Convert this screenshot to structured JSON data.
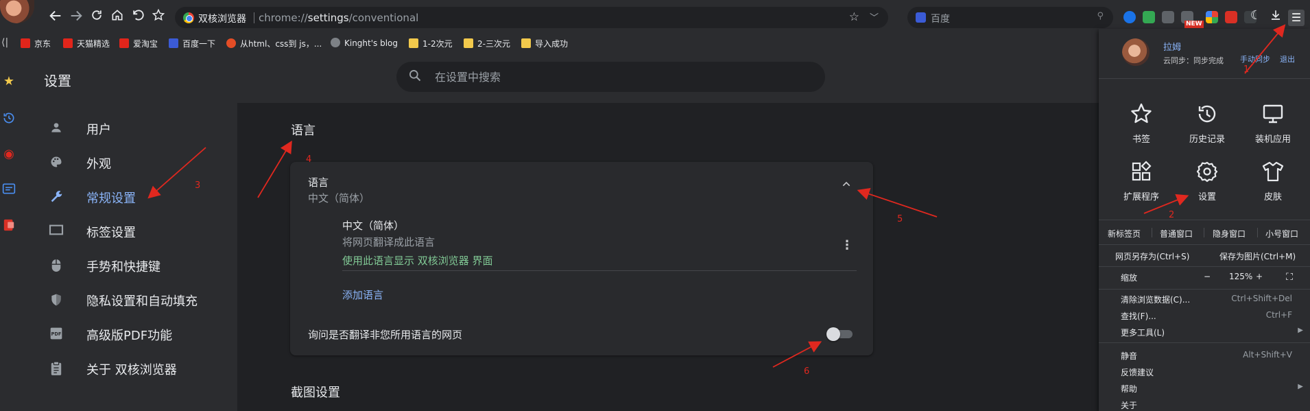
{
  "browser": {
    "omnibox": {
      "name": "双核浏览器",
      "url_prefix": "chrome://",
      "url_path": "settings",
      "url_rest": "/conventional"
    },
    "search_engine": {
      "placeholder": "百度"
    },
    "ext_badge": "NEW",
    "bookmarks": [
      {
        "label": "京东",
        "icon": "jd-icon",
        "color": "#e1251b"
      },
      {
        "label": "天猫精选",
        "icon": "tmall-icon",
        "color": "#e1251b"
      },
      {
        "label": "爱淘宝",
        "icon": "taobao-icon",
        "color": "#e1251b"
      },
      {
        "label": "百度一下",
        "icon": "baidu-icon",
        "color": "#3b5bd6"
      },
      {
        "label": "从html、css到 js，...",
        "icon": "html-icon",
        "color": "#e44d26"
      },
      {
        "label": "Kinght's blog",
        "icon": "globe-icon",
        "color": "#7d8186"
      },
      {
        "label": "1-2次元",
        "icon": "folder-icon",
        "color": "#f2c94c"
      },
      {
        "label": "2-三次元",
        "icon": "folder-icon",
        "color": "#f2c94c"
      },
      {
        "label": "导入成功",
        "icon": "folder-icon",
        "color": "#f2c94c"
      }
    ]
  },
  "settings": {
    "title": "设置",
    "search_placeholder": "在设置中搜索",
    "nav": [
      {
        "label": "用户",
        "icon": "person-icon",
        "active": false
      },
      {
        "label": "外观",
        "icon": "palette-icon",
        "active": false
      },
      {
        "label": "常规设置",
        "icon": "wrench-icon",
        "active": true
      },
      {
        "label": "标签设置",
        "icon": "tab-icon",
        "active": false
      },
      {
        "label": "手势和快捷键",
        "icon": "mouse-icon",
        "active": false
      },
      {
        "label": "隐私设置和自动填充",
        "icon": "shield-icon",
        "active": false
      },
      {
        "label": "高级版PDF功能",
        "icon": "pdf-icon",
        "active": false
      },
      {
        "label": "关于 双核浏览器",
        "icon": "clipboard-icon",
        "active": false
      }
    ],
    "language_section": {
      "heading": "语言",
      "card_title": "语言",
      "card_subtitle": "中文（简体）",
      "lang_name": "中文（简体）",
      "lang_desc": "将网页翻译成此语言",
      "lang_display": "使用此语言显示 双核浏览器 界面",
      "add_language": "添加语言",
      "ask_translate": "询问是否翻译非您所用语言的网页",
      "ask_translate_on": false
    },
    "screenshot_section": {
      "heading": "截图设置"
    }
  },
  "menu": {
    "user": "拉姆",
    "sync_status": "云同步：同步完成",
    "manual_sync": "手动同步",
    "logout": "退出",
    "tiles": [
      {
        "label": "书签",
        "icon": "star-outline-icon"
      },
      {
        "label": "历史记录",
        "icon": "history-icon"
      },
      {
        "label": "装机应用",
        "icon": "monitor-icon"
      },
      {
        "label": "扩展程序",
        "icon": "extensions-icon"
      },
      {
        "label": "设置",
        "icon": "gear-icon"
      },
      {
        "label": "皮肤",
        "icon": "shirt-icon"
      }
    ],
    "windows": [
      "新标签页",
      "普通窗口",
      "隐身窗口",
      "小号窗口"
    ],
    "save_page": "网页另存为(Ctrl+S)",
    "save_image": "保存为图片(Ctrl+M)",
    "zoom_label": "缩放",
    "zoom_minus": "−",
    "zoom_value": "125%",
    "zoom_plus": "+",
    "items": [
      {
        "label": "清除浏览数据(C)...",
        "shortcut": "Ctrl+Shift+Del",
        "submenu": false
      },
      {
        "label": "查找(F)...",
        "shortcut": "Ctrl+F",
        "submenu": false
      },
      {
        "label": "更多工具(L)",
        "shortcut": "",
        "submenu": true
      },
      {
        "label": "静音",
        "shortcut": "Alt+Shift+V",
        "submenu": false
      },
      {
        "label": "反馈建议",
        "shortcut": "",
        "submenu": false
      },
      {
        "label": "帮助",
        "shortcut": "",
        "submenu": true
      },
      {
        "label": "关于",
        "shortcut": "",
        "submenu": false
      }
    ]
  },
  "annotations": [
    "1",
    "2",
    "3",
    "4",
    "5",
    "6"
  ],
  "colors": {
    "accent": "#8ab4f8",
    "link_green": "#81c995",
    "annotation": "#e0281f"
  }
}
